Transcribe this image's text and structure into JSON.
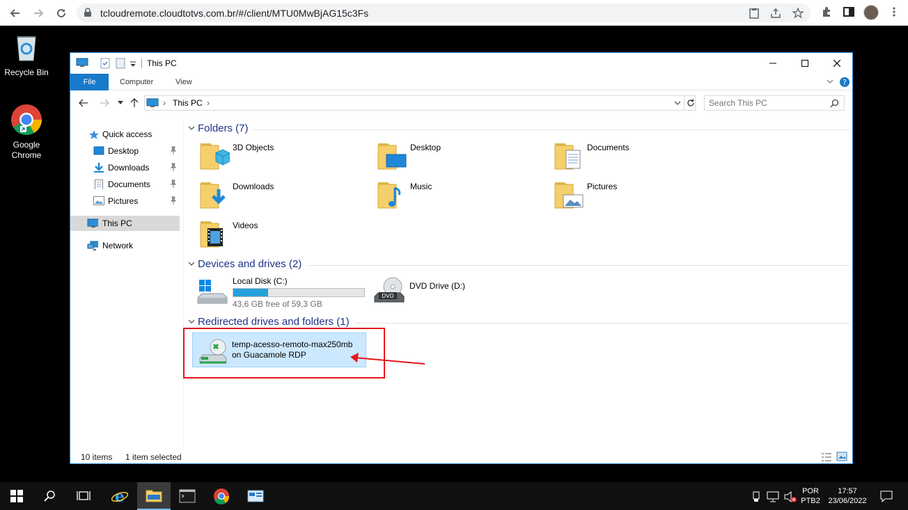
{
  "browser": {
    "url": "tcloudremote.cloudtotvs.com.br/#/client/MTU0MwBjAG15c3Fs"
  },
  "desktop": {
    "icons": [
      {
        "label": "Recycle Bin"
      },
      {
        "label": "Google Chrome"
      }
    ]
  },
  "explorer": {
    "title": "This PC",
    "ribbon_tabs": [
      "File",
      "Computer",
      "View"
    ],
    "breadcrumb": "This PC",
    "search_placeholder": "Search This PC",
    "nav": {
      "quick_access": "Quick access",
      "items": [
        "Desktop",
        "Downloads",
        "Documents",
        "Pictures"
      ],
      "this_pc": "This PC",
      "network": "Network"
    },
    "groups": {
      "folders": "Folders (7)",
      "devices": "Devices and drives (2)",
      "redirected": "Redirected drives and folders (1)"
    },
    "folders": [
      "3D Objects",
      "Desktop",
      "Documents",
      "Downloads",
      "Music",
      "Pictures",
      "Videos"
    ],
    "drives": {
      "local": {
        "name": "Local Disk (C:)",
        "free_text": "43,6 GB free of 59,3 GB",
        "used_fraction": 0.265
      },
      "dvd": {
        "name": "DVD Drive (D:)",
        "badge": "DVD"
      }
    },
    "redirected": {
      "line1": "temp-acesso-remoto-max250mb",
      "line2": "on Guacamole RDP"
    },
    "status": {
      "items": "10 items",
      "selected": "1 item selected"
    }
  },
  "taskbar": {
    "lang1": "POR",
    "lang2": "PTB2",
    "time": "17:57",
    "date": "23/06/2022"
  },
  "colors": {
    "accent": "#1979ca",
    "highlight": "#e5161b",
    "selection": "#cce8ff"
  }
}
